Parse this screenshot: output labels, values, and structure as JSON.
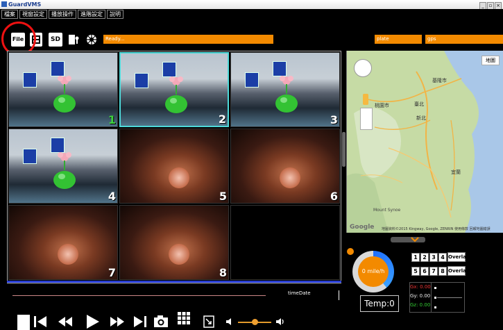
{
  "app": {
    "title": "GuardVMS",
    "window_buttons": [
      "_",
      "▫",
      "×"
    ]
  },
  "menu": [
    "檔案",
    "視窗設定",
    "播放操作",
    "進階設定",
    "說明"
  ],
  "toolbar": {
    "file_label": "File",
    "sd_label": "SD",
    "status_text": "Ready...",
    "plate_label": "plate",
    "gps_label": "gps"
  },
  "cameras": [
    {
      "num": "1",
      "type": "office",
      "selected": false,
      "num_color": "green"
    },
    {
      "num": "2",
      "type": "office",
      "selected": true,
      "num_color": "white"
    },
    {
      "num": "3",
      "type": "office",
      "selected": false,
      "num_color": "white"
    },
    {
      "num": "4",
      "type": "office",
      "selected": false,
      "num_color": "white"
    },
    {
      "num": "5",
      "type": "dark",
      "selected": false,
      "num_color": "white"
    },
    {
      "num": "6",
      "type": "dark",
      "selected": false,
      "num_color": "white"
    },
    {
      "num": "7",
      "type": "dark",
      "selected": false,
      "num_color": "white"
    },
    {
      "num": "8",
      "type": "dark",
      "selected": false,
      "num_color": "white"
    },
    {
      "num": "",
      "type": "empty",
      "selected": false,
      "num_color": "white"
    }
  ],
  "timeline": {
    "label": "timeDate"
  },
  "map": {
    "type_button": "地圖",
    "labels": [
      "基隆市",
      "臺北",
      "桃園市",
      "新北",
      "宜蘭"
    ],
    "attribution": "地圖資料©2015 Kingway, Google, ZENRIN   使用條款   回報地圖錯誤",
    "logo": "Google",
    "mount_label": "Mount Synoe"
  },
  "gauge": {
    "speed_text": "0 mile/h",
    "temp_text": "Temp:0"
  },
  "channel_buttons": [
    "1",
    "2",
    "3",
    "4",
    "5",
    "6",
    "7",
    "8"
  ],
  "overlay_buttons": [
    "Overlay1",
    "Overlay2"
  ],
  "gsensor": {
    "gx": "Gx: 0.00",
    "gy": "Gy: 0.00",
    "gz": "Gz: 0.00"
  },
  "colors": {
    "accent": "#f38a00",
    "select": "#4dd9d9",
    "timeline": "#2a3fd6"
  }
}
